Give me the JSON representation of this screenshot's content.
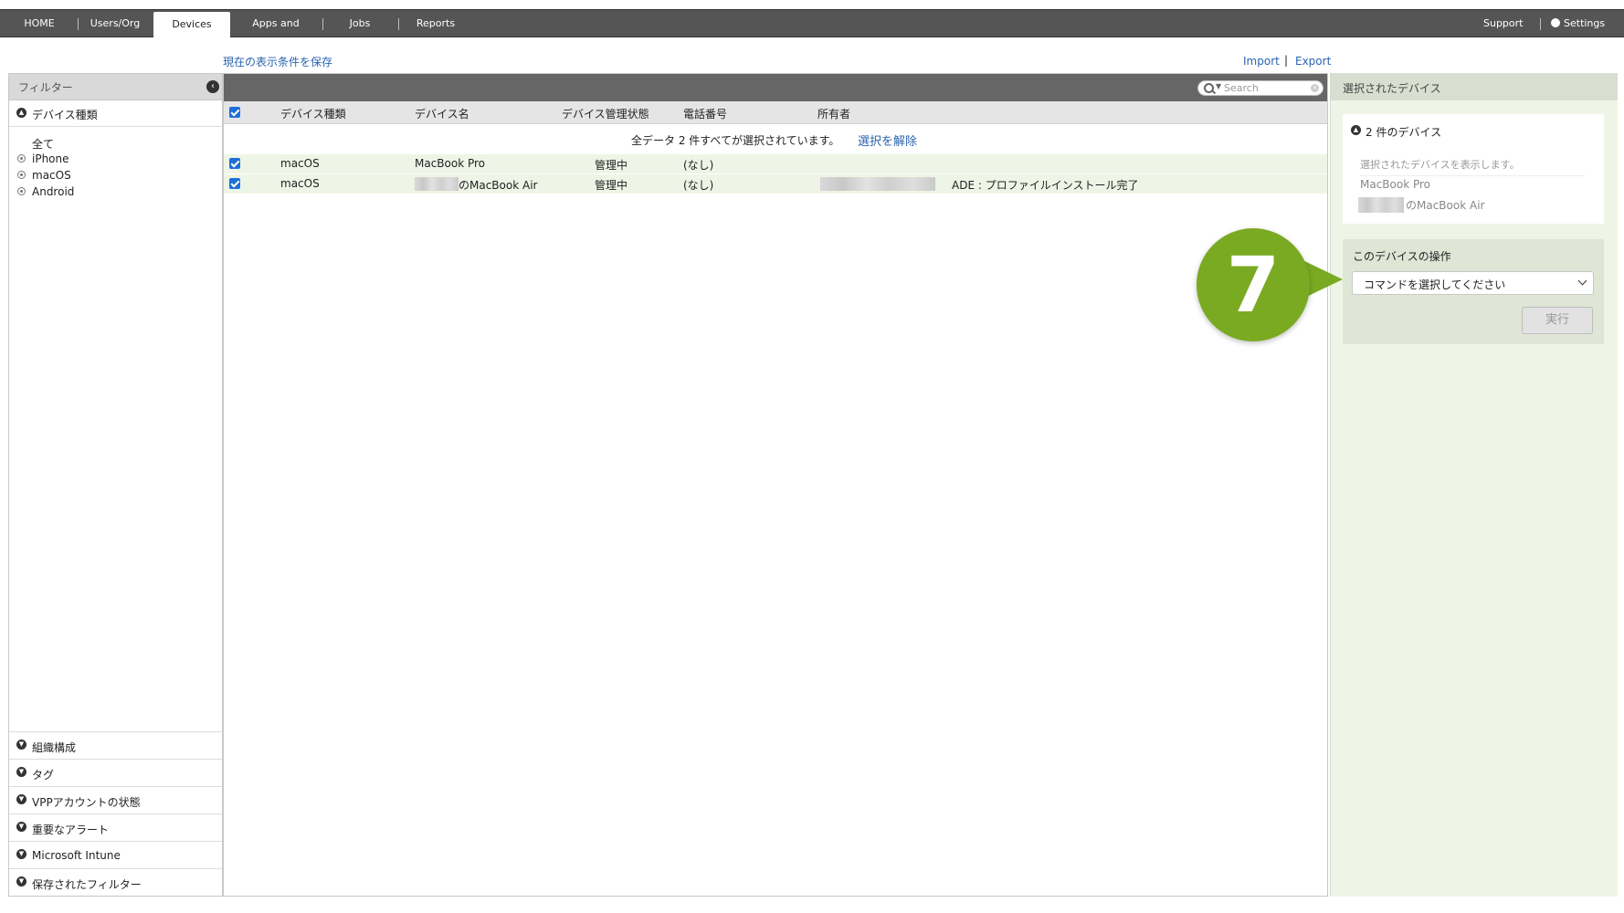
{
  "nav": {
    "tabs": [
      "HOME",
      "Users/Org",
      "Devices",
      "Apps and Books",
      "Jobs",
      "Reports"
    ],
    "active": "Devices",
    "support": "Support",
    "settings": "Settings"
  },
  "toolbar": {
    "save_view": "現在の表示条件を保存",
    "import": "Import",
    "separator": "|",
    "export": "Export"
  },
  "filter": {
    "title": "フィルター",
    "device_type_section": "デバイス種類",
    "items": [
      "全て",
      "iPhone",
      "macOS",
      "Android"
    ],
    "sections": [
      "組織構成",
      "タグ",
      "VPPアカウントの状態",
      "重要なアラート",
      "Microsoft Intune",
      "保存されたフィルター"
    ]
  },
  "search": {
    "placeholder": "Search"
  },
  "table": {
    "headers": [
      "デバイス種類",
      "デバイス名",
      "デバイス管理状態",
      "電話番号",
      "所有者"
    ],
    "selection_message": "全データ 2 件すべてが選択されています。",
    "clear_selection": "選択を解除",
    "rows": [
      {
        "type": "macOS",
        "name": "MacBook Pro",
        "status": "管理中",
        "phone": "(なし)",
        "note": ""
      },
      {
        "type": "macOS",
        "name": "のMacBook Air",
        "status": "管理中",
        "phone": "(なし)",
        "note": "ADE : プロファイルインストール完了"
      }
    ]
  },
  "selected": {
    "title": "選択されたデバイス",
    "count_label": "2 件のデバイス",
    "hint": "選択されたデバイスを表示します。",
    "devices": [
      "MacBook Pro",
      "のMacBook Air"
    ],
    "actions_title": "このデバイスの操作",
    "command_placeholder": "コマンドを選択してください",
    "run": "実行"
  },
  "callout": {
    "number": "7",
    "color": "#7aaa22"
  }
}
